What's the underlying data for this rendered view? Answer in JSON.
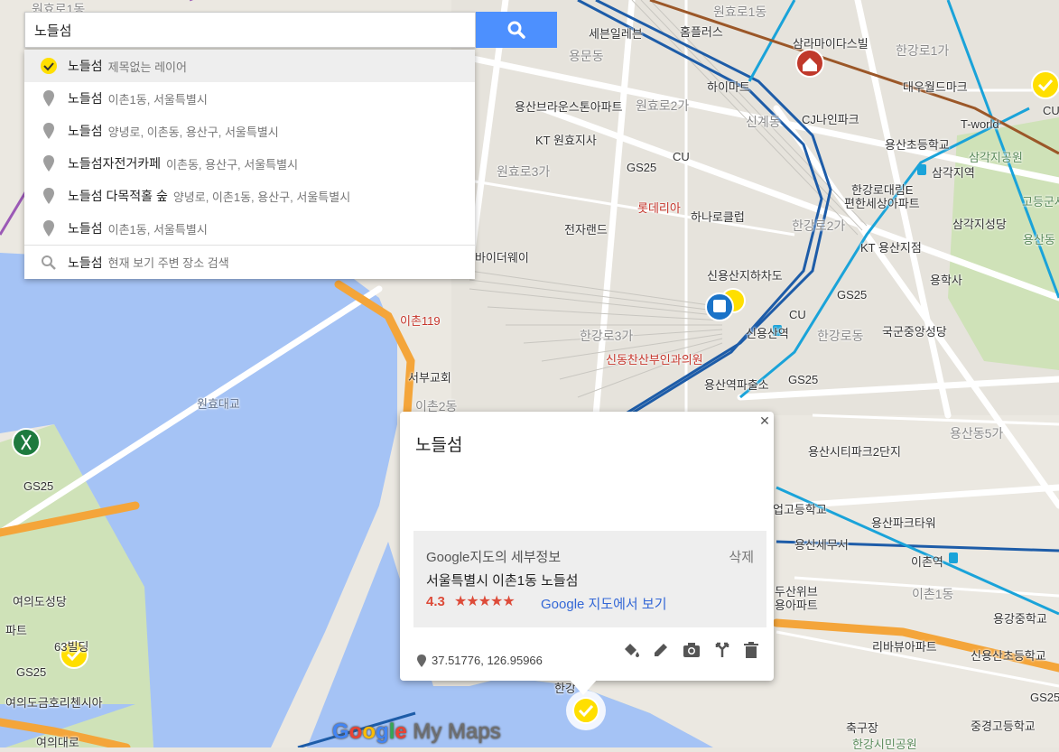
{
  "search": {
    "value": "노들섬",
    "button_icon": "search-icon"
  },
  "suggestions": [
    {
      "main": "노들섬",
      "sub": "제목없는 레이어",
      "icon": "check-marker-icon",
      "active": true
    },
    {
      "main": "노들섬",
      "sub": "이촌1동, 서울특별시",
      "icon": "pin-icon"
    },
    {
      "main": "노들섬",
      "sub": "양녕로, 이촌동, 용산구, 서울특별시",
      "icon": "pin-icon"
    },
    {
      "main": "노들섬자전거카페",
      "sub": "이촌동, 용산구, 서울특별시",
      "icon": "pin-icon"
    },
    {
      "main": "노들섬 다목적홀 숲",
      "sub": "양녕로, 이촌1동, 용산구, 서울특별시",
      "icon": "pin-icon"
    },
    {
      "main": "노들섬",
      "sub": "이촌1동, 서울특별시",
      "icon": "pin-icon"
    },
    {
      "main": "노들섬",
      "sub": "현재 보기 주변 장소 검색",
      "icon": "search-icon"
    }
  ],
  "info": {
    "title": "노들섬",
    "close_icon": "close-icon",
    "details_heading": "Google지도의 세부정보",
    "delete_label": "삭제",
    "address": "서울특별시 이촌1동 노들섬",
    "rating": "4.3",
    "stars": "★★★★★",
    "maps_link": "Google 지도에서 보기",
    "coordinates": "37.51776, 126.95966",
    "tools": [
      "paint-bucket-icon",
      "edit-pencil-icon",
      "camera-icon",
      "directions-icon",
      "trash-icon"
    ]
  },
  "map_labels": {
    "l1": "원효로1동",
    "l2": "세븐일레븐",
    "l3": "홈플러스",
    "l4": "삼라마이다스빌",
    "l5": "한강로1가",
    "l6": "용문동",
    "l7": "하이마트",
    "l8": "대우월드마크",
    "l9": "용산브라운스톤아파트",
    "l10": "원효로2가",
    "l11": "신계동",
    "l12": "CJ나인파크",
    "l13": "T-world",
    "l14": "KT 원효지사",
    "l15": "용산초등학교",
    "l16": "삼각지공원",
    "l17": "원효로3가",
    "l18": "GS25",
    "l19": "CU",
    "l20": "삼각지역",
    "l21": "한강로대림E",
    "l22": "편한세상아파트",
    "l23": "롯데리아",
    "l24": "하나로클럽",
    "l25": "고등군사",
    "l26": "전자랜드",
    "l27": "한강로2가",
    "l28": "삼각지성당",
    "l29": "용산동",
    "l30": "KT 용산지점",
    "l31": "바이더웨이",
    "l32": "신용산지하차도",
    "l33": "용학사",
    "l34": "GS25",
    "l35": "이촌119",
    "l36": "CU",
    "l37": "신용산역",
    "l38": "한강로동",
    "l39": "국군중앙성당",
    "l40": "한강로3가",
    "l41": "신동찬산부인과의원",
    "l42": "서부교회",
    "l43": "용산역파출소",
    "l44": "GS25",
    "l45": "원효대교",
    "l46": "이촌2동",
    "l47": "용산동5가",
    "l48": "용산시티파크2단지",
    "l49": "GS25",
    "l50": "업고등학교",
    "l51": "용산파크타워",
    "l52": "용산세무서",
    "l53": "이촌역",
    "l54": "여의도성당",
    "l55": "이촌1동",
    "l56": "두산위브",
    "l57": "용아파트",
    "l58": "용강중학교",
    "l59": "파트",
    "l60": "63빌딩",
    "l61": "리바뷰아파트",
    "l62": "신용산초등학교",
    "l63": "GS25",
    "l64": "여의도금호리첸시아",
    "l65": "한강",
    "l66": "GS25",
    "l67": "축구장",
    "l68": "중경고등학교",
    "l69": "한강시민공원",
    "l70": "CU",
    "l71": "여의대로",
    "l72": "한강대교"
  },
  "logo": {
    "google": "Google",
    "mymaps": "My Maps"
  },
  "colors": {
    "water": "#a5c3f5",
    "park": "#c8dfae",
    "highway": "#f4a53a",
    "subway_line1": "#1d5ca8",
    "subway_line4": "#1aa3d9",
    "subway_brown": "#9b5728",
    "accent_blue": "#4d90fe",
    "marker_yellow": "#ffdf00"
  }
}
